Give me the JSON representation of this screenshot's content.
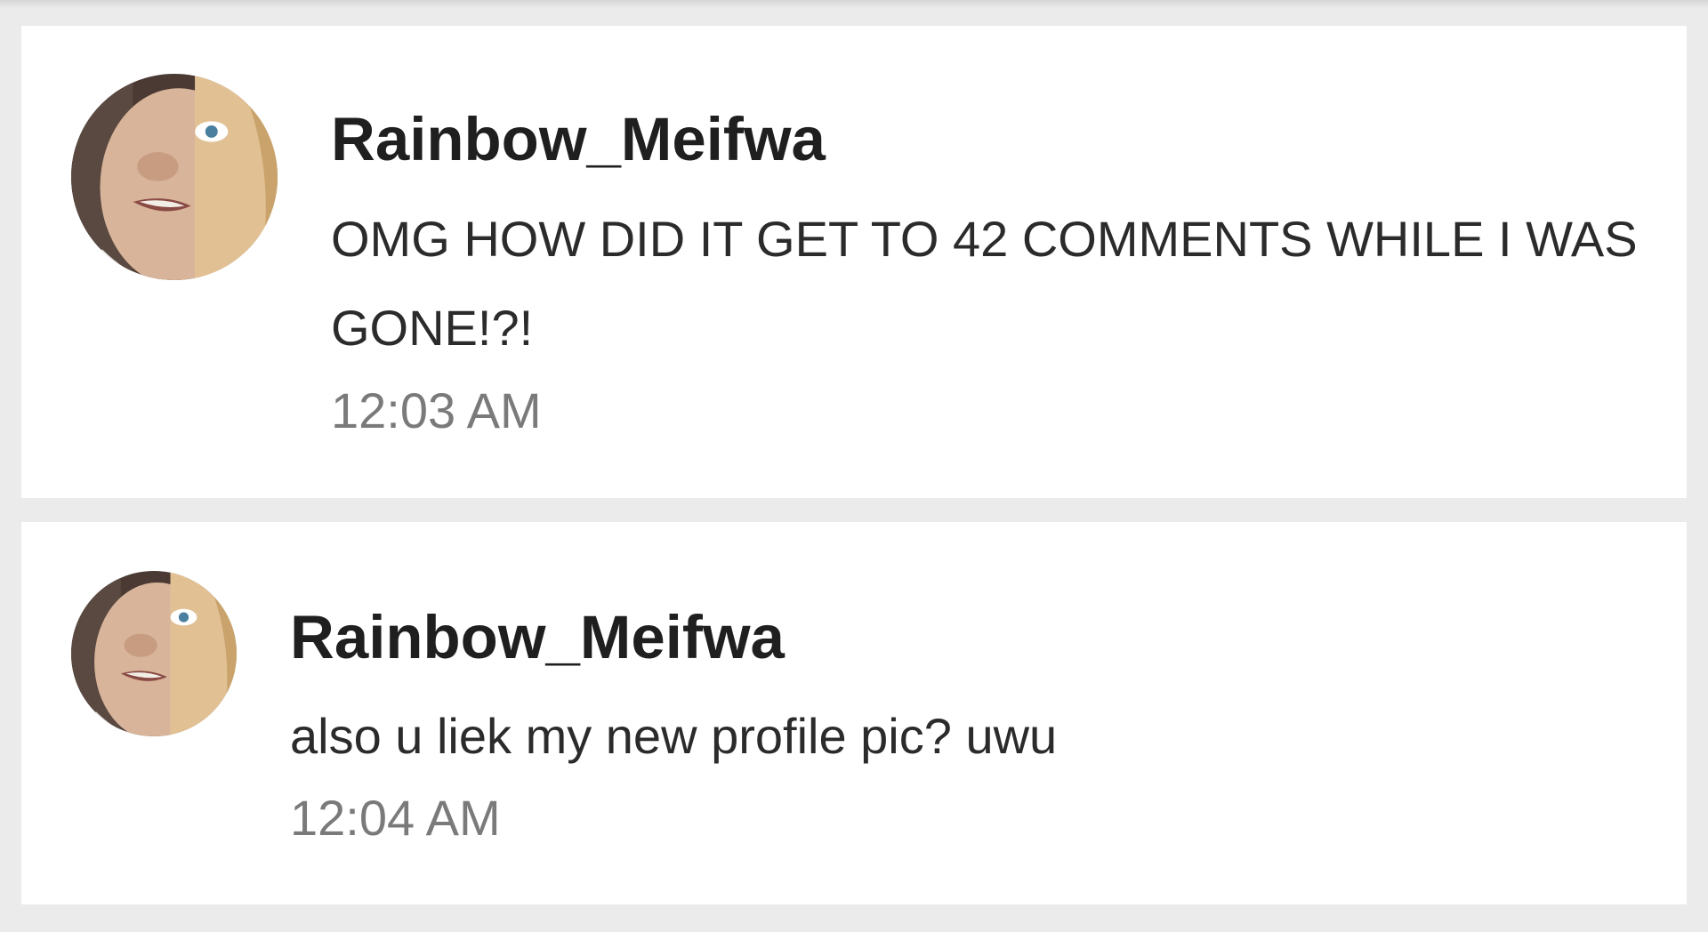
{
  "comments": [
    {
      "username": "Rainbow_Meifwa",
      "message": "OMG HOW DID IT GET TO 42 COMMENTS WHILE I WAS GONE!?!",
      "time": "12:03 AM"
    },
    {
      "username": "Rainbow_Meifwa",
      "message": "also u liek my new profile pic? uwu",
      "time": "12:04 AM"
    }
  ]
}
